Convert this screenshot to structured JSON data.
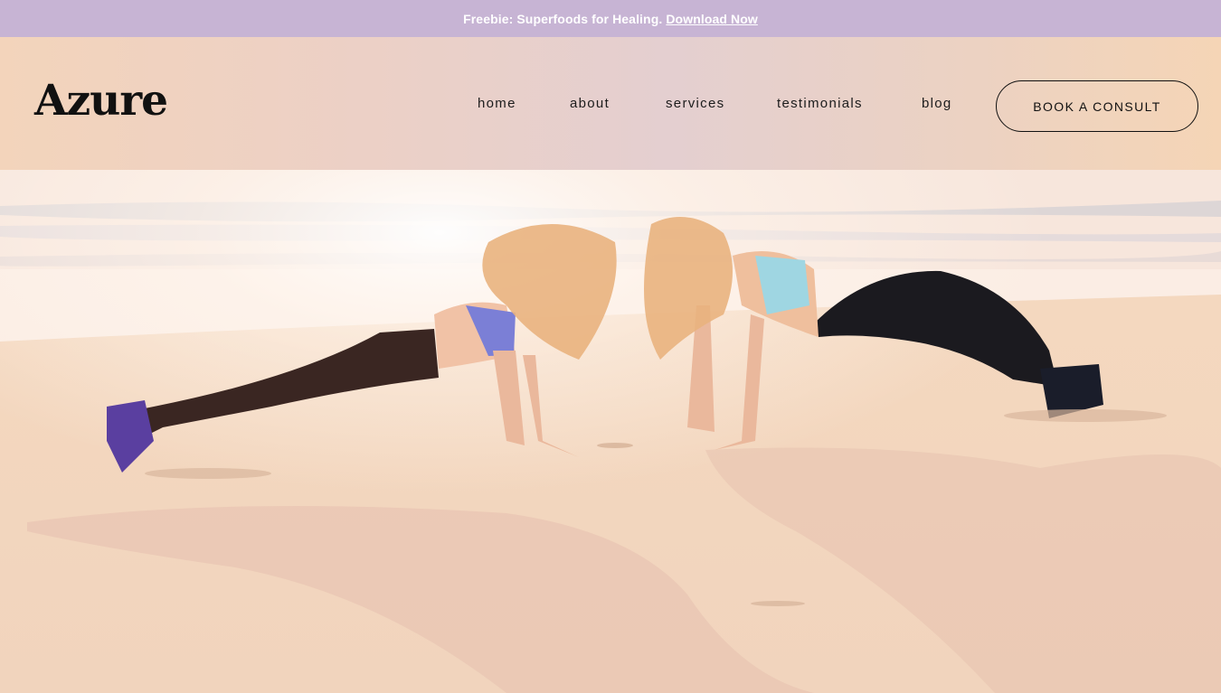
{
  "announcement": {
    "text": "Freebie: Superfoods for Healing.",
    "link_label": "Download Now"
  },
  "header": {
    "logo": "Azure",
    "nav": [
      "home",
      "about",
      "services",
      "testimonials",
      "blog"
    ],
    "cta_label": "BOOK A CONSULT"
  },
  "colors": {
    "announcement_bg": "#c7b4d4",
    "header_bg": "#ecd0c6",
    "text": "#111111"
  },
  "hero": {
    "image_description_icon": "beach-plank-photo"
  }
}
